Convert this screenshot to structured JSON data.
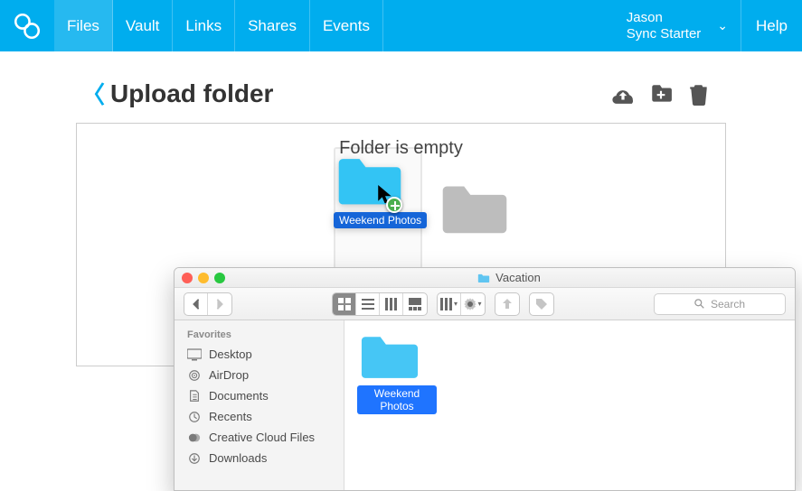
{
  "nav": {
    "items": [
      "Files",
      "Vault",
      "Links",
      "Shares",
      "Events"
    ],
    "active_index": 0,
    "user_name": "Jason",
    "user_plan": "Sync Starter",
    "help": "Help"
  },
  "page": {
    "title": "Upload folder",
    "empty_text": "Folder is empty"
  },
  "drag": {
    "label": "Weekend Photos"
  },
  "finder": {
    "title": "Vacation",
    "search_placeholder": "Search",
    "sidebar": {
      "heading": "Favorites",
      "items": [
        "Desktop",
        "AirDrop",
        "Documents",
        "Recents",
        "Creative Cloud Files",
        "Downloads"
      ]
    },
    "file": {
      "label": "Weekend Photos"
    }
  }
}
